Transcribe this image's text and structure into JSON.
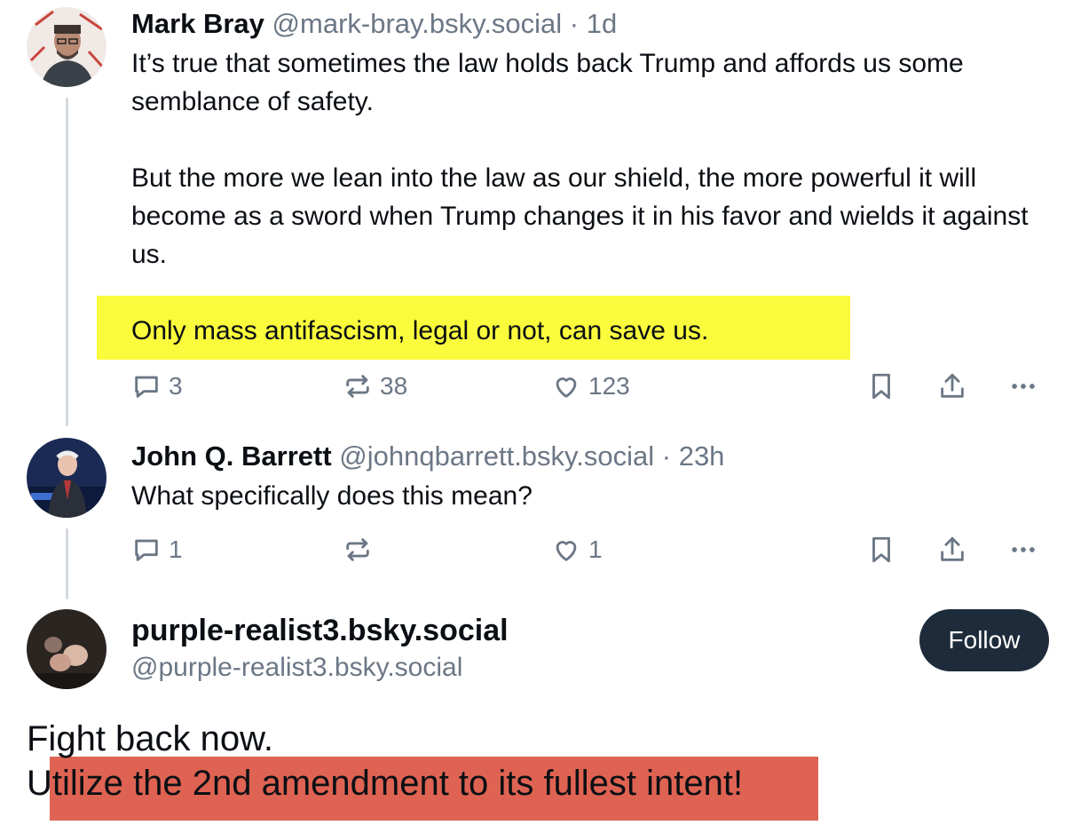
{
  "posts": [
    {
      "author": "Mark Bray",
      "handle": "@mark-bray.bsky.social",
      "separator": "·",
      "time": "1d",
      "para1": "It’s true that sometimes the law holds back Trump and affords us some semblance of safety.",
      "para2": "But the more we lean into the law as our shield, the more powerful it will become as a sword when Trump changes it in his favor and wields it against us.",
      "para3": "Only mass antifascism, legal or not, can save us.",
      "replies": "3",
      "reposts": "38",
      "likes": "123"
    },
    {
      "author": "John Q. Barrett",
      "handle": "@johnqbarrett.bsky.social",
      "separator": "·",
      "time": "23h",
      "text": "What specifically does this mean?",
      "replies": "1",
      "reposts": "",
      "likes": "1"
    }
  ],
  "profile": {
    "display_name": "purple-realist3.bsky.social",
    "handle": "@purple-realist3.bsky.social",
    "follow_label": "Follow"
  },
  "reply": {
    "line1": "Fight back now.",
    "line2": "Utilize the 2nd amendment to its fullest intent!"
  },
  "colors": {
    "highlight_yellow": "#f9fb3c",
    "highlight_red": "#df6352",
    "follow_button": "#1e2b3a",
    "muted_text": "#6b7785"
  },
  "icons": [
    "reply-icon",
    "repost-icon",
    "like-icon",
    "bookmark-icon",
    "share-icon",
    "more-icon"
  ]
}
